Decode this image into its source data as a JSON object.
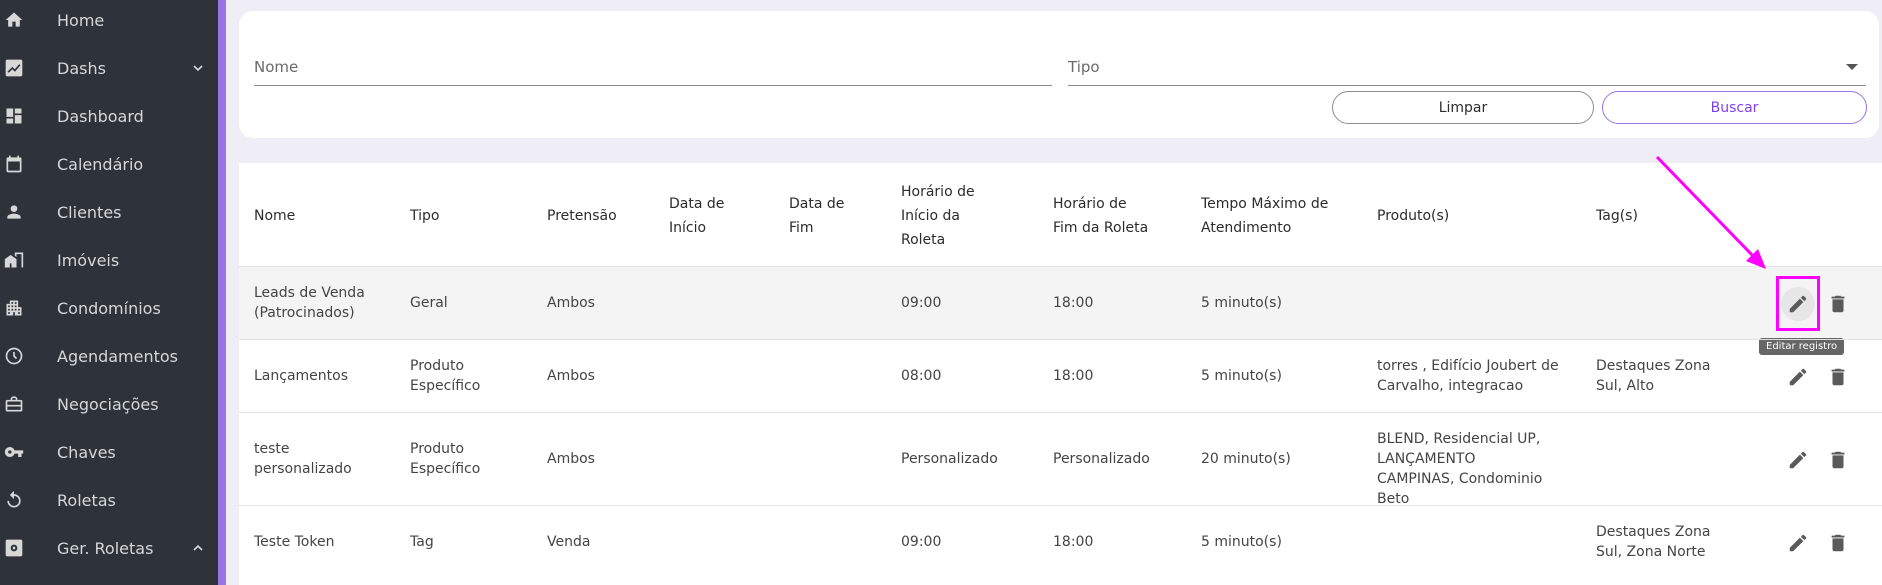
{
  "sidebar": {
    "items": [
      {
        "label": "Home",
        "icon": "home-icon"
      },
      {
        "label": "Dashs",
        "icon": "chart-icon"
      },
      {
        "label": "Dashboard",
        "icon": "dashboard-icon"
      },
      {
        "label": "Calendário",
        "icon": "calendar-icon"
      },
      {
        "label": "Clientes",
        "icon": "person-icon"
      },
      {
        "label": "Imóveis",
        "icon": "building-icon"
      },
      {
        "label": "Condomínios",
        "icon": "apartment-icon"
      },
      {
        "label": "Agendamentos",
        "icon": "clock-icon"
      },
      {
        "label": "Negociações",
        "icon": "briefcase-icon"
      },
      {
        "label": "Chaves",
        "icon": "key-icon"
      },
      {
        "label": "Roletas",
        "icon": "rotate-icon"
      },
      {
        "label": "Ger. Roletas",
        "icon": "settings-icon"
      }
    ]
  },
  "filters": {
    "nome_label": "Nome",
    "tipo_label": "Tipo",
    "clear_label": "Limpar",
    "search_label": "Buscar"
  },
  "table": {
    "headers": {
      "nome": "Nome",
      "tipo": "Tipo",
      "pretensao": "Pretensão",
      "data_inicio": "Data de Início",
      "data_fim": "Data de Fim",
      "horario_inicio": "Horário de Início da Roleta",
      "horario_fim": "Horário de Fim da Roleta",
      "tempo_max": "Tempo Máximo de Atendimento",
      "produtos": "Produto(s)",
      "tags": "Tag(s)"
    },
    "rows": [
      {
        "nome": "Leads de Venda (Patrocinados)",
        "tipo": "Geral",
        "pretensao": "Ambos",
        "inicio": "09:00",
        "fim": "18:00",
        "tempo": "5 minuto(s)",
        "produtos": "",
        "tags": ""
      },
      {
        "nome": "Lançamentos",
        "tipo": "Produto Específico",
        "pretensao": "Ambos",
        "inicio": "08:00",
        "fim": "18:00",
        "tempo": "5 minuto(s)",
        "produtos": "torres , Edifício Joubert de Carvalho, integracao",
        "tags": "Destaques Zona Sul, Alto"
      },
      {
        "nome": "teste personalizado",
        "tipo": "Produto Específico",
        "pretensao": "Ambos",
        "inicio": "Personalizado",
        "fim": "Personalizado",
        "tempo": "20 minuto(s)",
        "produtos": "BLEND, Residencial UP, LANÇAMENTO CAMPINAS, Condominio Beto",
        "tags": ""
      },
      {
        "nome": "Teste Token",
        "tipo": "Tag",
        "pretensao": "Venda",
        "inicio": "09:00",
        "fim": "18:00",
        "tempo": "5 minuto(s)",
        "produtos": "",
        "tags": "Destaques Zona Sul, Zona Norte"
      }
    ],
    "tooltip": "Editar registro"
  },
  "colors": {
    "sidebar": "#2d3338",
    "accent": "#9a73e6",
    "highlight": "#ff00ff"
  }
}
